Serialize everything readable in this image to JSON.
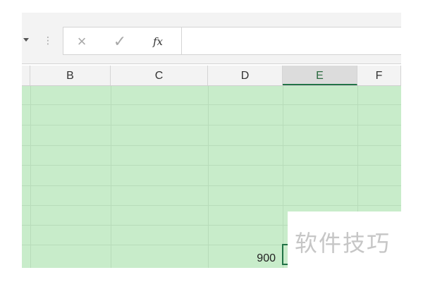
{
  "formula_bar": {
    "dots": "⋮",
    "cancel_icon": "×",
    "enter_icon": "✓",
    "insert_function_label": "fx",
    "formula_value": ""
  },
  "columns": [
    "B",
    "C",
    "D",
    "E",
    "F"
  ],
  "selected_column": "E",
  "cell": {
    "value": "900"
  },
  "watermark": "软件技巧",
  "colors": {
    "selection_fill": "#c8ecca",
    "accent": "#217346"
  }
}
